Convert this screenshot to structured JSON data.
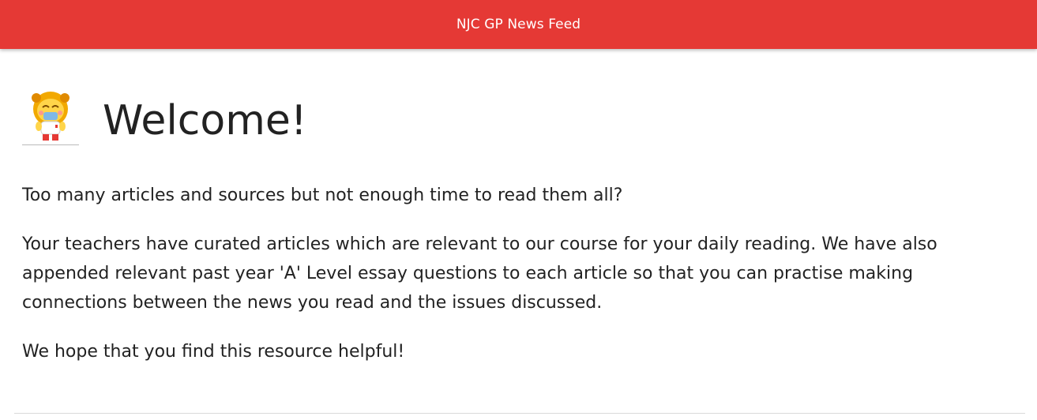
{
  "header": {
    "title": "NJC GP News Feed"
  },
  "hero": {
    "mascot_icon": "lion-mascot-icon",
    "heading": "Welcome!"
  },
  "intro": {
    "paragraphs": [
      "Too many articles and sources but not enough time to read them all?",
      "Your teachers have curated articles which are relevant to our course for your daily reading. We have also appended relevant past year 'A' Level essay questions to each article so that you can practise making connections between the news you read and the issues discussed.",
      "We hope that you find this resource helpful!"
    ]
  },
  "colors": {
    "header_bg": "#e53935",
    "header_text": "#ffffff",
    "body_text": "#222222"
  }
}
